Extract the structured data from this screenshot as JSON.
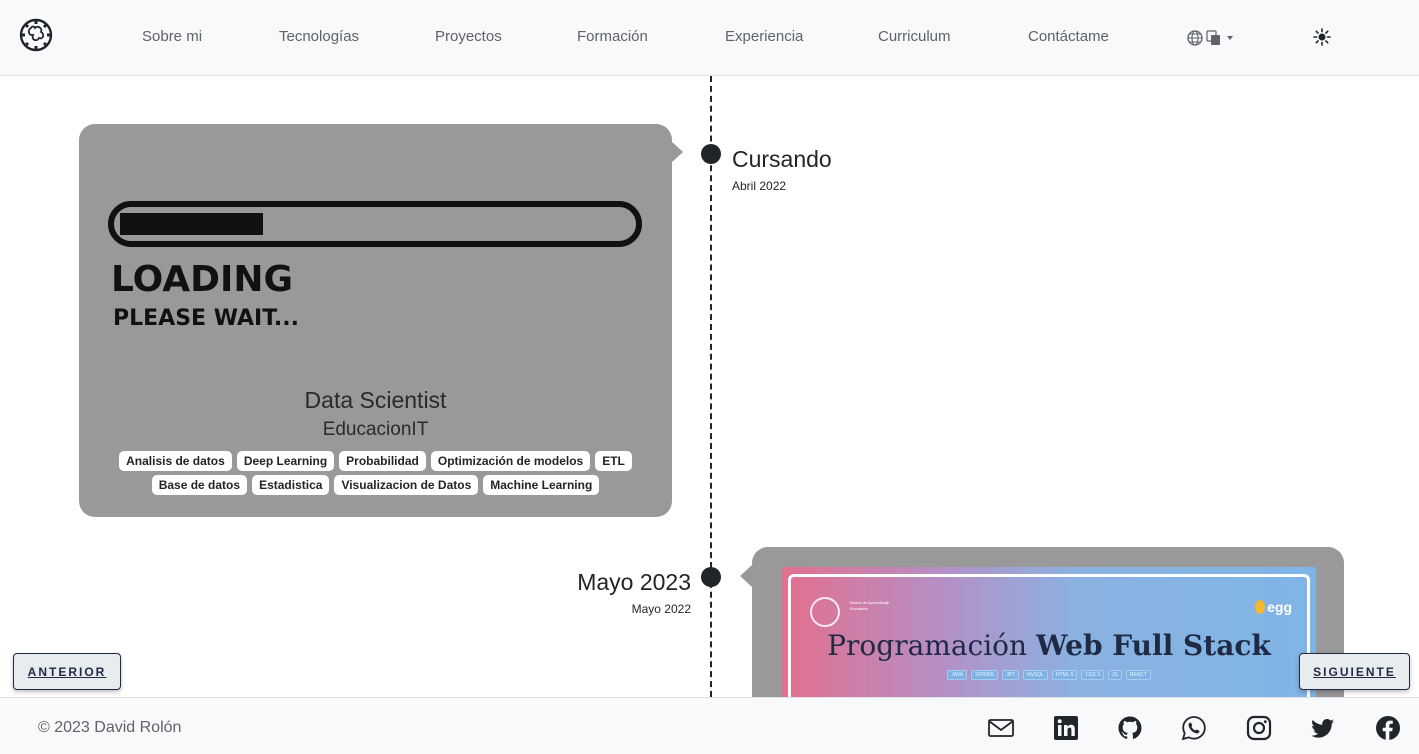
{
  "nav": {
    "logo_icon": "gear-brain-logo-icon",
    "items": [
      {
        "label": "Sobre mi"
      },
      {
        "label": "Tecnologías"
      },
      {
        "label": "Proyectos"
      },
      {
        "label": "Formación"
      },
      {
        "label": "Experiencia"
      },
      {
        "label": "Curriculum"
      },
      {
        "label": "Contáctame"
      }
    ],
    "language_icon": "globe-translate-icon",
    "theme_icon": "sun-icon"
  },
  "timeline": [
    {
      "title": "Cursando",
      "date": "Abril 2022",
      "card": {
        "image": {
          "line1": "LOADING",
          "line2": "PLEASE WAIT...",
          "progress": 0.28
        },
        "name": "Data Scientist",
        "institution": "EducacionIT",
        "tags": [
          "Analisis de datos",
          "Deep Learning",
          "Probabilidad",
          "Optimización de modelos",
          "ETL",
          "Base de datos",
          "Estadistica",
          "Visualizacion de Datos",
          "Machine Learning"
        ]
      }
    },
    {
      "title": "Mayo 2023",
      "date": "Mayo 2022",
      "card": {
        "banner": {
          "title_light": "Programación",
          "title_bold": "Web Full Stack",
          "brand": "egg",
          "chips": [
            "JAVA",
            "SPRING",
            "JPT",
            "MySQL",
            "HTML 5",
            "CSS 3",
            "JS",
            "REACT"
          ]
        }
      }
    }
  ],
  "buttons": {
    "prev": "ANTERIOR",
    "next": "SIGUIENTE"
  },
  "footer": {
    "copyright": "© 2023 David Rolón",
    "social_icons": [
      "mail-icon",
      "linkedin-icon",
      "github-icon",
      "whatsapp-icon",
      "instagram-icon",
      "twitter-icon",
      "facebook-icon"
    ]
  },
  "colors": {
    "card_bg": "#999999",
    "line": "#212529",
    "footer_bg": "#f8f9fa"
  }
}
